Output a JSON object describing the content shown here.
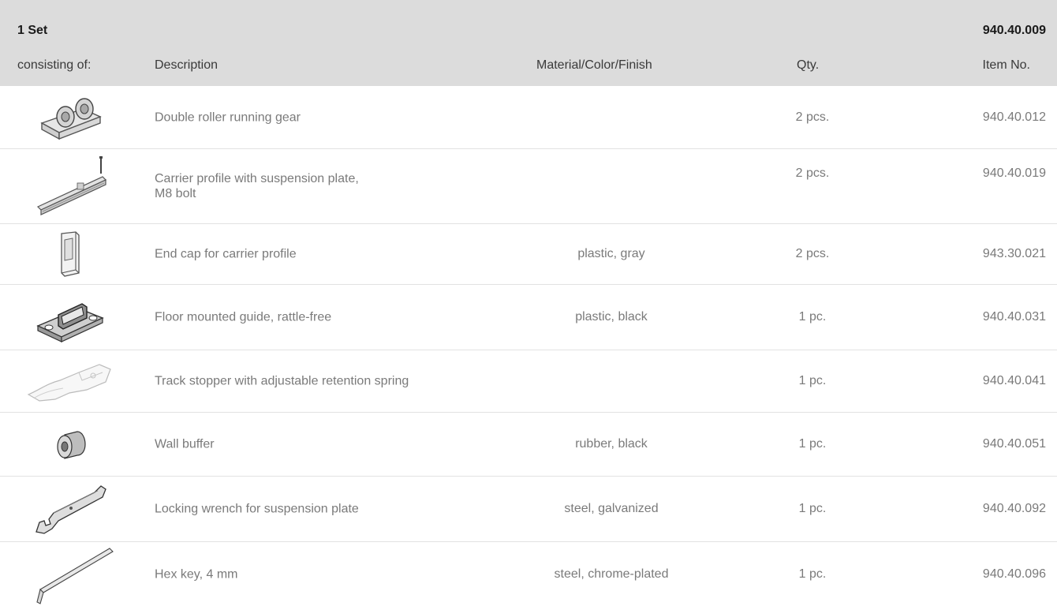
{
  "header": {
    "set_label": "1 Set",
    "set_item_no": "940.40.009",
    "columns": {
      "consisting": "consisting of:",
      "description": "Description",
      "material": "Material/Color/Finish",
      "qty": "Qty.",
      "item_no": "Item No."
    }
  },
  "rows": [
    {
      "icon": "double-roller-running-gear-icon",
      "description": "Double roller running gear",
      "description_line2": "",
      "material": "",
      "qty": "2 pcs.",
      "item_no": "940.40.012"
    },
    {
      "icon": "carrier-profile-icon",
      "description": "Carrier profile with suspension plate,",
      "description_line2": "M8 bolt",
      "material": "",
      "qty": "2 pcs.",
      "item_no": "940.40.019"
    },
    {
      "icon": "end-cap-icon",
      "description": "End cap for carrier profile",
      "description_line2": "",
      "material": "plastic, gray",
      "qty": "2 pcs.",
      "item_no": "943.30.021"
    },
    {
      "icon": "floor-guide-icon",
      "description": "Floor mounted guide, rattle-free",
      "description_line2": "",
      "material": "plastic, black",
      "qty": "1 pc.",
      "item_no": "940.40.031"
    },
    {
      "icon": "track-stopper-icon",
      "description": "Track stopper with adjustable retention spring",
      "description_line2": "",
      "material": "",
      "qty": "1 pc.",
      "item_no": "940.40.041"
    },
    {
      "icon": "wall-buffer-icon",
      "description": "Wall buffer",
      "description_line2": "",
      "material": "rubber, black",
      "qty": "1 pc.",
      "item_no": "940.40.051"
    },
    {
      "icon": "locking-wrench-icon",
      "description": "Locking wrench for suspension plate",
      "description_line2": "",
      "material": "steel, galvanized",
      "qty": "1 pc.",
      "item_no": "940.40.092"
    },
    {
      "icon": "hex-key-icon",
      "description": "Hex key, 4 mm",
      "description_line2": "",
      "material": "steel, chrome-plated",
      "qty": "1 pc.",
      "item_no": "940.40.096"
    }
  ]
}
